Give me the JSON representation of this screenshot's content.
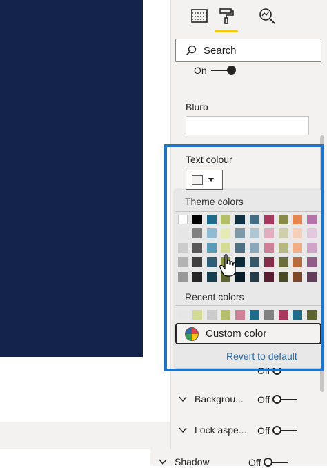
{
  "panel": {
    "search_placeholder": "Search",
    "on_toggle_label": "On",
    "blurb_label": "Blurb",
    "text_colour_label": "Text colour",
    "theme_colors_label": "Theme colors",
    "recent_colors_label": "Recent colors",
    "custom_color_label": "Custom color",
    "revert_label": "Revert to default",
    "sections": [
      {
        "label": "Backgrou...",
        "toggle": "Off"
      },
      {
        "label": "Lock aspe...",
        "toggle": "Off"
      },
      {
        "label": "Shadow",
        "toggle": "Off"
      }
    ],
    "hidden_row_toggle": "Off"
  },
  "colors": {
    "canvas_visual": "#13234b",
    "accent_underline": "#f2c811",
    "highlight_box": "#1f74c8",
    "theme_columns": [
      [
        "#ffffff",
        "#e6e6e6",
        "#cccccc",
        "#b3b3b3",
        "#999999"
      ],
      [
        "#000000",
        "#808080",
        "#595959",
        "#404040",
        "#262626"
      ],
      [
        "#1f6b8b",
        "#8fbcd2",
        "#5b9bb8",
        "#2e5f78",
        "#173f52"
      ],
      [
        "#b5bf6b",
        "#e6eab4",
        "#d4db92",
        "#8a9344",
        "#5d6430"
      ],
      [
        "#0f3344",
        "#7d98a6",
        "#4d7183",
        "#0c2a38",
        "#081d27"
      ],
      [
        "#456e85",
        "#b0c6d3",
        "#8aa8ba",
        "#375869",
        "#253c48"
      ],
      [
        "#a8385d",
        "#e2aebf",
        "#d07f99",
        "#862d4a",
        "#5a1e32"
      ],
      [
        "#888a4a",
        "#cfd0ab",
        "#b6b883",
        "#6c6e3b",
        "#494a28"
      ],
      [
        "#e6864e",
        "#f6cfb8",
        "#f0ad86",
        "#b86b3e",
        "#7c4829"
      ],
      [
        "#b574a8",
        "#e3c9dd",
        "#d0a4c6",
        "#915d86",
        "#613e5a"
      ]
    ],
    "recent": [
      "#e6e6e6",
      "#d4db92",
      "#cccccc",
      "#b5bf6b",
      "#d07f99",
      "#1f6b8b",
      "#808080",
      "#a8385d",
      "#1f6b8b",
      "#5d6430"
    ]
  },
  "icons": [
    "table-format-icon",
    "paint-roller-icon",
    "analytics-icon",
    "search-icon",
    "color-wheel-icon",
    "chevron-down-icon",
    "hand-cursor-icon"
  ]
}
